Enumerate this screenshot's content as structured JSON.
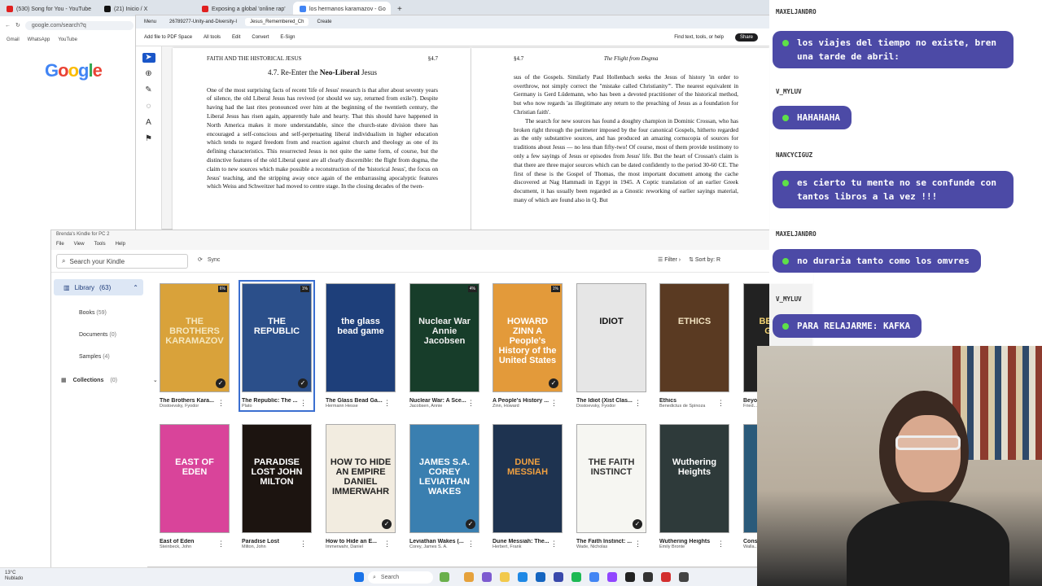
{
  "browser": {
    "tabs": [
      {
        "label": "(530) Song for You - YouTube",
        "color": "#e02020"
      },
      {
        "label": "(21) Inicio / X",
        "color": "#111111"
      },
      {
        "label": "Exposing a global 'online rap'",
        "color": "#e02020"
      },
      {
        "label": "los hermanos karamazov - Go",
        "color": "#4285f4"
      }
    ],
    "address": "google.com/search?q",
    "bookmarks": [
      "Gmail",
      "WhatsApp",
      "YouTube"
    ],
    "google_logo": "Google"
  },
  "pdf": {
    "tabs": [
      "Menu",
      "26789277-Unity-and-Diversity-I",
      "Jesus_Remembered_Ch",
      "Create"
    ],
    "toolbar": [
      "Add file to PDF Space",
      "All tools",
      "Edit",
      "Convert",
      "E-Sign"
    ],
    "find": "Find text, tools, or help",
    "share": "Share",
    "left_page": {
      "header_left": "FAITH AND THE HISTORICAL JESUS",
      "header_right": "§4.7",
      "section": "4.7. Re-Enter the ",
      "section_bold": "Neo-Liberal",
      "section_end": " Jesus",
      "body": "One of the most surprising facts of recent 'life of Jesus' research is that after about seventy years of silence, the old Liberal Jesus has revived (or should we say, returned from exile?). Despite having had the last rites pronounced over him at the beginning of the twentieth century, the Liberal Jesus has risen again, apparently hale and hearty. That this should have happened in North America makes it more understandable, since the church-state division there has encouraged a self-conscious and self-perpetuating liberal individualism in higher education which tends to regard freedom from and reaction against church and theology as one of its defining characteristics. This resurrected Jesus is not quite the same form, of course, but the distinctive features of the old Liberal quest are all clearly discernible: the flight from dogma, the claim to new sources which make possible a reconstruction of the 'historical Jesus', the focus on Jesus' teaching, and the stripping away once again of the embarrassing apocalyptic features which Weiss and Schweitzer had moved to centre stage. In the closing decades of the twen-"
    },
    "right_page": {
      "header_left": "§4.7",
      "header_right": "The Flight from Dogma",
      "body": "sus of the Gospels. Similarly Paul Hollenbach seeks the Jesus of history 'in order to overthrow, not simply correct the \"mistake called Christianity\"'. The nearest equivalent in Germany is Gerd Lüdemann, who has been a devoted practitioner of the historical method, but who now regards 'as illegitimate any return to the preaching of Jesus as a foundation for Christian faith'.",
      "body2": "The search for new sources has found a doughty champion in Dominic Crossan, who has broken right through the perimeter imposed by the four canonical Gospels, hitherto regarded as the only substantive sources, and has produced an amazing cornucopia of sources for traditions about Jesus — no less than fifty-two! Of course, most of them provide testimony to only a few sayings of Jesus or episodes from Jesus' life. But the heart of Crossan's claim is that there are three major sources which can be dated confidently to the period 30-60 CE. The first of these is the Gospel of Thomas, the most important document among the cache discovered at Nag Hammadi in Egypt in 1945. A Coptic translation of an earlier Greek document, it has usually been regarded as a Gnostic reworking of earlier sayings material, many of which are found also in Q. But"
    }
  },
  "kindle": {
    "title": "Brenda's Kindle for PC 2",
    "menu": [
      "File",
      "View",
      "Tools",
      "Help"
    ],
    "search_placeholder": "Search your Kindle",
    "sync": "Sync",
    "filter": "Filter",
    "sort": "Sort by: R",
    "library_label": "Library",
    "library_count": "(63)",
    "sidebar": [
      {
        "label": "Books",
        "count": "(59)"
      },
      {
        "label": "Documents",
        "count": "(0)"
      },
      {
        "label": "Samples",
        "count": "(4)"
      }
    ],
    "collections": "Collections",
    "collections_count": "(0)",
    "books": [
      {
        "title": "The Brothers Kara...",
        "author": "Dostoevsky, Fyodor",
        "cover": "THE BROTHERS KARAMAZOV",
        "bg": "#d9a23a",
        "fg": "#f5e8c0",
        "pct": "6%",
        "check": true
      },
      {
        "title": "The Republic: The ...",
        "author": "Plato",
        "cover": "THE REPUBLIC",
        "bg": "#2b4f8a",
        "fg": "#ffffff",
        "pct": "1%",
        "check": true
      },
      {
        "title": "The Glass Bead Ga...",
        "author": "Hermann Hesse",
        "cover": "the glass bead game",
        "bg": "#1e3f7a",
        "fg": "#ffffff",
        "pct": "",
        "check": false
      },
      {
        "title": "Nuclear War: A Sce...",
        "author": "Jacobsen, Annie",
        "cover": "Nuclear War Annie Jacobsen",
        "bg": "#173d2a",
        "fg": "#f0f0f0",
        "pct": "4%",
        "check": false
      },
      {
        "title": "A People's History ...",
        "author": "Zinn, Howard",
        "cover": "HOWARD ZINN A People's History of the United States",
        "bg": "#e39a3a",
        "fg": "#ffffff",
        "pct": "1%",
        "check": true
      },
      {
        "title": "The Idiot (Xist Clas...",
        "author": "Dostoevsky, Fyodor",
        "cover": "IDIOT",
        "bg": "#e6e6e6",
        "fg": "#111111",
        "pct": "",
        "check": false
      },
      {
        "title": "Ethics",
        "author": "Benedictus de Spinoza",
        "cover": "ETHICS",
        "bg": "#5a3a22",
        "fg": "#f2e2c0",
        "pct": "",
        "check": false
      },
      {
        "title": "Beyo...",
        "author": "Fried...",
        "cover": "BEYOND GOOD",
        "bg": "#222222",
        "fg": "#f0d070",
        "pct": "",
        "check": false
      },
      {
        "title": "East of Eden",
        "author": "Steinbeck, John",
        "cover": "EAST OF EDEN",
        "bg": "#d9449a",
        "fg": "#ffffff",
        "pct": "",
        "check": false
      },
      {
        "title": "Paradise Lost",
        "author": "Milton, John",
        "cover": "PARADISE LOST JOHN MILTON",
        "bg": "#1c1410",
        "fg": "#ffffff",
        "pct": "",
        "check": false
      },
      {
        "title": "How to Hide an E...",
        "author": "Immerwahr, Daniel",
        "cover": "HOW TO HIDE AN EMPIRE DANIEL IMMERWAHR",
        "bg": "#f2ece0",
        "fg": "#222222",
        "pct": "",
        "check": true
      },
      {
        "title": "Leviathan Wakes (...",
        "author": "Corey, James S. A.",
        "cover": "JAMES S.A. COREY LEVIATHAN WAKES",
        "bg": "#3a7fb0",
        "fg": "#ffffff",
        "pct": "",
        "check": true
      },
      {
        "title": "Dune Messiah: The...",
        "author": "Herbert, Frank",
        "cover": "DUNE MESSIAH",
        "bg": "#1e3350",
        "fg": "#f0a040",
        "pct": "",
        "check": false
      },
      {
        "title": "The Faith Instinct: ...",
        "author": "Wade, Nicholas",
        "cover": "THE FAITH INSTINCT",
        "bg": "#f6f6f2",
        "fg": "#333333",
        "pct": "",
        "check": true
      },
      {
        "title": "Wuthering Heights",
        "author": "Emily Bronte",
        "cover": "Wuthering Heights",
        "bg": "#2e3a3a",
        "fg": "#ffffff",
        "pct": "",
        "check": false
      },
      {
        "title": "Cons...",
        "author": "Walla...",
        "cover": "",
        "bg": "#2a5a7a",
        "fg": "#ffffff",
        "pct": "",
        "check": false
      }
    ]
  },
  "chat": [
    {
      "user": "MAXELJANDRO",
      "text": "los viajes del tiempo no existe, bren una tarde de abril:"
    },
    {
      "user": "V_MYLUV",
      "text": "HAHAHAHA"
    },
    {
      "user": "NANCYCIGUZ",
      "text": "es cierto tu mente no se confunde con tantos libros a la vez !!!"
    },
    {
      "user": "MAXELJANDRO",
      "text": "no duraria tanto como los omvres"
    },
    {
      "user": "V_MYLUV",
      "text": "PARA RELAJARME: KAFKA"
    }
  ],
  "taskbar": {
    "weather_temp": "13°C",
    "weather_desc": "Nublado",
    "search": "Search"
  }
}
